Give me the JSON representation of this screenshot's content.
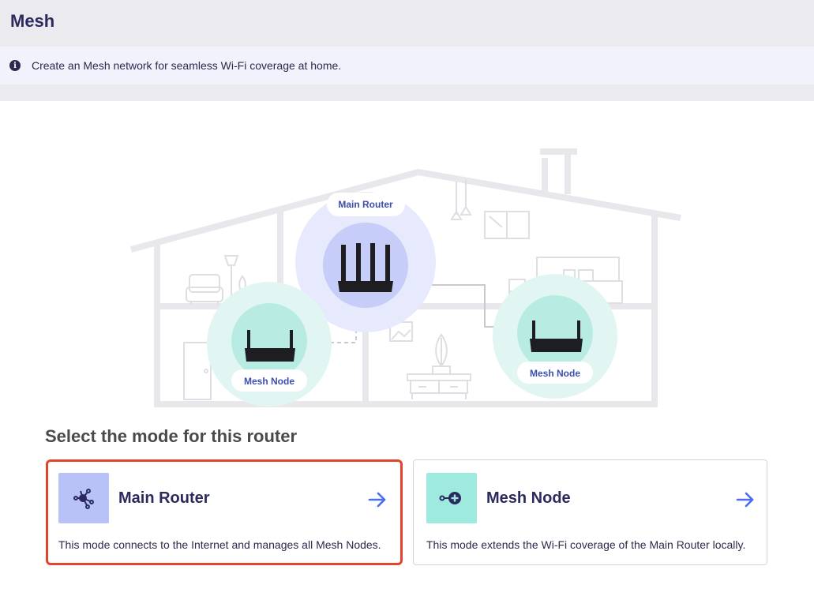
{
  "page": {
    "title": "Mesh"
  },
  "info": {
    "text": "Create an Mesh network for seamless Wi-Fi coverage at home."
  },
  "illustration": {
    "main_router_label": "Main Router",
    "mesh_node_left_label": "Mesh Node",
    "mesh_node_right_label": "Mesh Node"
  },
  "mode_select": {
    "title": "Select the mode for this router",
    "options": [
      {
        "title": "Main Router",
        "description": "This mode connects to the Internet and manages all Mesh Nodes.",
        "selected": true
      },
      {
        "title": "Mesh Node",
        "description": "This mode extends the Wi-Fi coverage of the Main Router locally.",
        "selected": false
      }
    ]
  },
  "colors": {
    "accent": "#4a6cf7",
    "selected_border": "#e2452f",
    "main_icon_bg": "#b9c2f7",
    "node_icon_bg": "#9eeadf",
    "title_text": "#2b2a5e"
  }
}
